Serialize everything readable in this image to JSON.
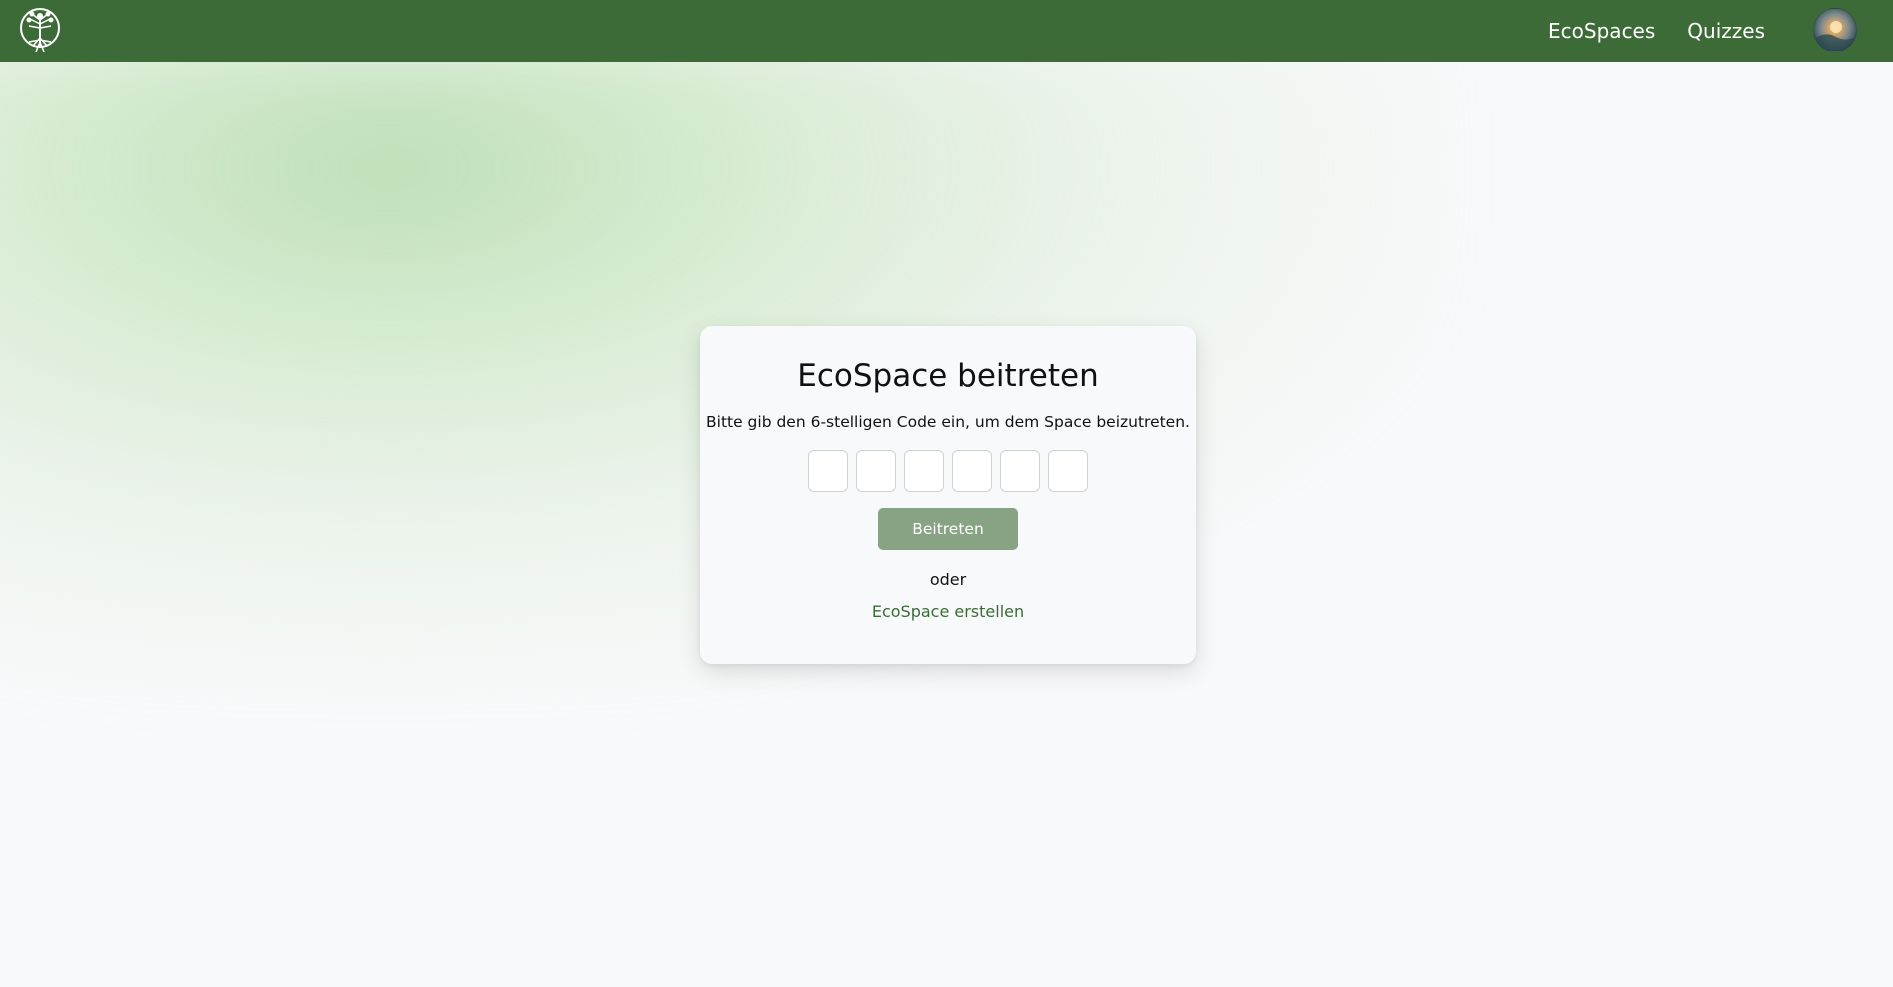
{
  "navbar": {
    "logo_icon": "tree-of-life-icon",
    "links": [
      {
        "label": "EcoSpaces"
      },
      {
        "label": "Quizzes"
      }
    ],
    "avatar_icon": "user-avatar-icon"
  },
  "card": {
    "title": "EcoSpace beitreten",
    "subtitle": "Bitte gib den 6-stelligen Code ein, um dem Space beizutreten.",
    "code_digits": [
      "",
      "",
      "",
      "",
      "",
      ""
    ],
    "join_label": "Beitreten",
    "or_label": "oder",
    "create_label": "EcoSpace erstellen"
  },
  "colors": {
    "navbar_bg": "#3d6b37",
    "button_bg": "#87a383",
    "link": "#3d6b37",
    "page_bg": "#f8f9fa"
  }
}
